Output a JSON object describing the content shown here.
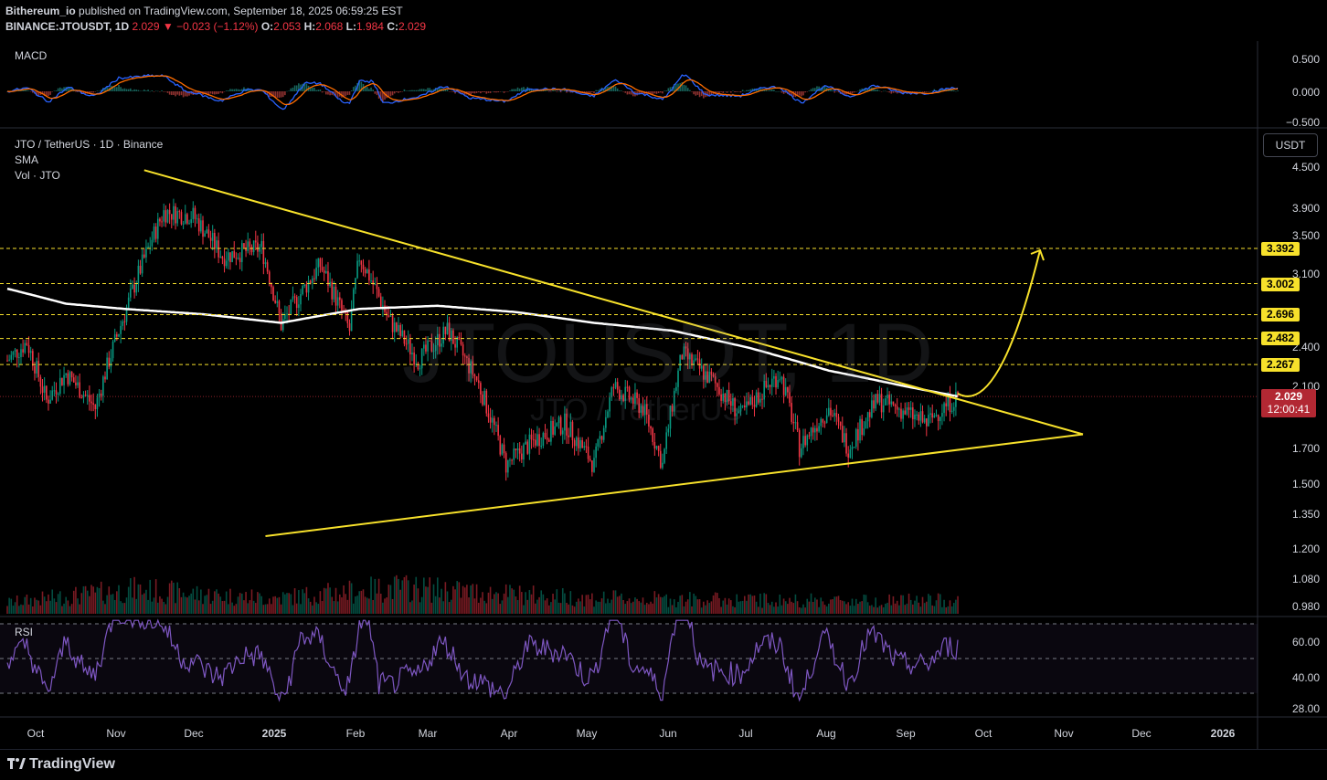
{
  "header": {
    "publisher": "Bithereum_io",
    "published_text": " published on TradingView.com, September 18, 2025 06:59:25 EST",
    "symbol": "BINANCE:JTOUSDT, 1D",
    "last": "2.029",
    "change": "−0.023 (−1.12%)",
    "o_label": "O:",
    "o": "2.053",
    "h_label": "H:",
    "h": "2.068",
    "l_label": "L:",
    "l": "1.984",
    "c_label": "C:",
    "c": "2.029"
  },
  "labels": {
    "macd": "MACD",
    "pair": "JTO / TetherUS · 1D · Binance",
    "sma": "SMA",
    "vol": "Vol · JTO",
    "rsi": "RSI",
    "usdt_button": "USDT",
    "watermark_big": "JTOUSDT, 1D",
    "watermark_small": "JTO / TetherUS",
    "tradingview": "TradingView"
  },
  "price_tag": {
    "price": "2.029",
    "countdown": "12:00:41"
  },
  "colors": {
    "up": "#089981",
    "down": "#f23645",
    "trendline": "#f7e12b",
    "sma": "#ffffff",
    "macd": "#2962ff",
    "signal": "#ff6d00",
    "rsi": "#7e57c2"
  },
  "chart_data": [
    {
      "type": "candlestick",
      "title": "JTO / TetherUS · 1D · Binance",
      "x_months": [
        "Oct",
        "Nov",
        "Dec",
        "2025",
        "Feb",
        "Mar",
        "Apr",
        "May",
        "Jun",
        "Jul",
        "Aug",
        "Sep",
        "Oct",
        "Nov",
        "Dec",
        "2026"
      ],
      "y_ticks": [
        "4.500",
        "3.900",
        "3.500",
        "3.100",
        "2.400",
        "2.100",
        "1.900",
        "1.700",
        "1.500",
        "1.350",
        "1.200",
        "1.080",
        "0.980"
      ],
      "scale": "log",
      "price_keypoints": [
        [
          0,
          2.3
        ],
        [
          10,
          2.45
        ],
        [
          20,
          2.0
        ],
        [
          30,
          2.2
        ],
        [
          45,
          1.95
        ],
        [
          60,
          2.7
        ],
        [
          80,
          3.85
        ],
        [
          95,
          3.8
        ],
        [
          110,
          3.3
        ],
        [
          130,
          3.4
        ],
        [
          140,
          2.6
        ],
        [
          160,
          3.2
        ],
        [
          175,
          2.55
        ],
        [
          180,
          3.3
        ],
        [
          195,
          2.65
        ],
        [
          210,
          2.3
        ],
        [
          225,
          2.55
        ],
        [
          240,
          2.15
        ],
        [
          255,
          1.6
        ],
        [
          270,
          1.75
        ],
        [
          285,
          1.85
        ],
        [
          300,
          1.6
        ],
        [
          310,
          2.1
        ],
        [
          325,
          1.95
        ],
        [
          335,
          1.6
        ],
        [
          345,
          2.35
        ],
        [
          360,
          2.15
        ],
        [
          375,
          1.9
        ],
        [
          385,
          2.05
        ],
        [
          395,
          2.2
        ],
        [
          405,
          1.7
        ],
        [
          420,
          1.95
        ],
        [
          430,
          1.7
        ],
        [
          445,
          2.0
        ],
        [
          455,
          1.95
        ],
        [
          470,
          1.85
        ],
        [
          478,
          1.95
        ],
        [
          486,
          2.029
        ]
      ],
      "sma_keypoints": [
        [
          0,
          2.95
        ],
        [
          30,
          2.8
        ],
        [
          60,
          2.75
        ],
        [
          100,
          2.7
        ],
        [
          140,
          2.62
        ],
        [
          180,
          2.75
        ],
        [
          220,
          2.78
        ],
        [
          260,
          2.72
        ],
        [
          300,
          2.62
        ],
        [
          340,
          2.55
        ],
        [
          380,
          2.4
        ],
        [
          420,
          2.22
        ],
        [
          460,
          2.1
        ],
        [
          486,
          2.03
        ]
      ],
      "volume_keypoints": [
        [
          0,
          0.25
        ],
        [
          65,
          0.55
        ],
        [
          95,
          0.45
        ],
        [
          135,
          0.35
        ],
        [
          200,
          0.6
        ],
        [
          255,
          0.45
        ],
        [
          300,
          0.35
        ],
        [
          400,
          0.3
        ],
        [
          486,
          0.3
        ]
      ],
      "horizontal_levels": [
        {
          "label": "3.392",
          "value": 3.392
        },
        {
          "label": "3.002",
          "value": 3.002
        },
        {
          "label": "2.696",
          "value": 2.696
        },
        {
          "label": "2.482",
          "value": 2.482
        },
        {
          "label": "2.267",
          "value": 2.267
        }
      ],
      "triangle": {
        "upper": [
          [
            70,
            4.45
          ],
          [
            550,
            1.78
          ]
        ],
        "lower": [
          [
            132,
            1.25
          ],
          [
            550,
            1.78
          ]
        ]
      },
      "projection_target": 3.392,
      "last_price": 2.029
    },
    {
      "type": "line",
      "title": "MACD",
      "y_ticks": [
        "0.500",
        "0.000",
        "−0.500"
      ],
      "ylim": [
        -0.6,
        0.6
      ]
    },
    {
      "type": "line",
      "title": "RSI",
      "y_ticks": [
        "60.00",
        "40.00",
        "28.00"
      ],
      "bands": [
        70,
        50,
        30
      ]
    }
  ]
}
